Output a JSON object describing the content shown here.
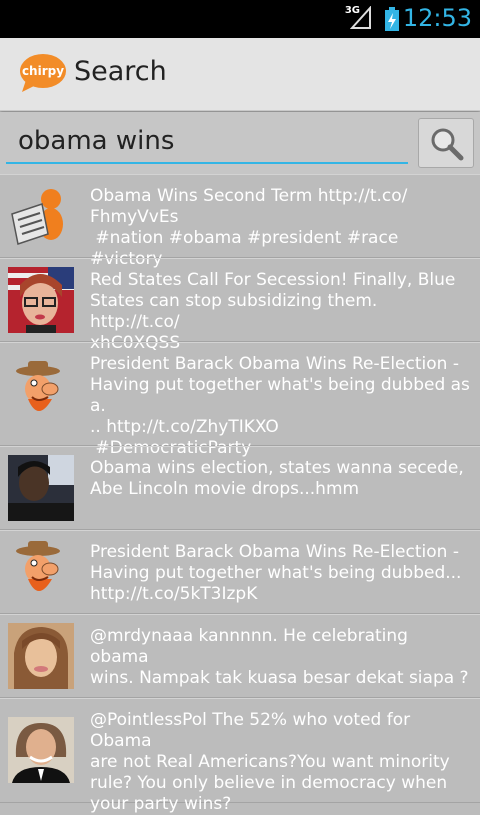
{
  "status_bar": {
    "network": "3G",
    "time": "12:53"
  },
  "action_bar": {
    "title": "Search",
    "logo_text": "chirpy",
    "logo_icon": "chirpy-speech-bubble-logo"
  },
  "search": {
    "value": "obama wins",
    "button_icon": "search-icon"
  },
  "tweets": [
    {
      "avatar": "newspaper-reader-avatar",
      "text": "Obama Wins Second Term http://t.co/\nFhmyVvEs\n #nation #obama #president #race #victory"
    },
    {
      "avatar": "woman-glasses-flag-avatar",
      "text": "Red States Call For Secession! Finally, Blue\nStates can stop subsidizing them.  http://t.co/\nxhC0XQSS"
    },
    {
      "avatar": "cartoon-cowboy-avatar",
      "text": "President Barack Obama Wins Re-Election -\nHaving put together what's being dubbed as a.\n.. http://t.co/ZhyTIKXO\n #DemocraticParty"
    },
    {
      "avatar": "man-in-car-avatar",
      "text": "Obama wins election, states wanna secede,\nAbe Lincoln movie drops...hmm"
    },
    {
      "avatar": "cartoon-cowboy-avatar",
      "text": "President Barack Obama Wins Re-Election -\nHaving put together what's being dubbed...\nhttp://t.co/5kT3IzpK"
    },
    {
      "avatar": "woman-portrait-avatar",
      "text": "@mrdynaaa kannnnn. He celebrating obama\nwins. Nampak tak kuasa besar dekat siapa ?"
    },
    {
      "avatar": "man-tuxedo-avatar",
      "text": "@PointlessPol The 52% who voted for Obama\nare not Real Americans?You want minority\nrule? You only believe in democracy when\nyour party wins?"
    }
  ]
}
